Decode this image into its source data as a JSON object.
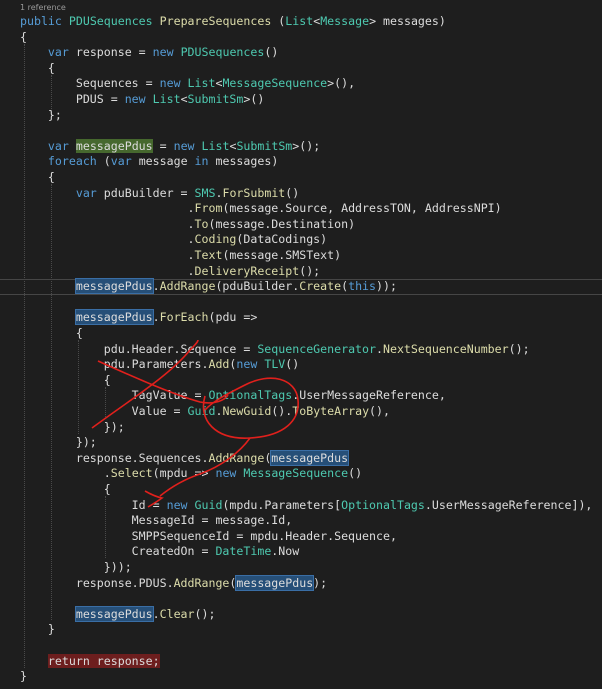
{
  "codelens": "1 reference",
  "lines": [
    {
      "tokens": [
        [
          "k",
          "public "
        ],
        [
          "t",
          "PDUSequences"
        ],
        [
          "pl",
          " "
        ],
        [
          "m",
          "PrepareSequences"
        ],
        [
          "pl",
          " ("
        ],
        [
          "t",
          "List"
        ],
        [
          "pl",
          "<"
        ],
        [
          "t",
          "Message"
        ],
        [
          "pl",
          "> messages)"
        ]
      ]
    },
    {
      "tokens": [
        [
          "pl",
          "{"
        ]
      ]
    },
    {
      "tokens": [
        [
          "pl",
          "    "
        ],
        [
          "k",
          "var"
        ],
        [
          "pl",
          " response = "
        ],
        [
          "k",
          "new"
        ],
        [
          "pl",
          " "
        ],
        [
          "t",
          "PDUSequences"
        ],
        [
          "pl",
          "()"
        ]
      ]
    },
    {
      "tokens": [
        [
          "pl",
          "    {"
        ]
      ]
    },
    {
      "tokens": [
        [
          "pl",
          "        Sequences = "
        ],
        [
          "k",
          "new"
        ],
        [
          "pl",
          " "
        ],
        [
          "t",
          "List"
        ],
        [
          "pl",
          "<"
        ],
        [
          "t",
          "MessageSequence"
        ],
        [
          "pl",
          ">(),"
        ]
      ]
    },
    {
      "tokens": [
        [
          "pl",
          "        PDUS = "
        ],
        [
          "k",
          "new"
        ],
        [
          "pl",
          " "
        ],
        [
          "t",
          "List"
        ],
        [
          "pl",
          "<"
        ],
        [
          "t",
          "SubmitSm"
        ],
        [
          "pl",
          ">()"
        ]
      ]
    },
    {
      "tokens": [
        [
          "pl",
          "    };"
        ]
      ]
    },
    {
      "tokens": []
    },
    {
      "tokens": [
        [
          "pl",
          "    "
        ],
        [
          "k",
          "var"
        ],
        [
          "pl",
          " "
        ],
        [
          "hg",
          "messagePdus"
        ],
        [
          "pl",
          " = "
        ],
        [
          "k",
          "new"
        ],
        [
          "pl",
          " "
        ],
        [
          "t",
          "List"
        ],
        [
          "pl",
          "<"
        ],
        [
          "t",
          "SubmitSm"
        ],
        [
          "pl",
          ">();"
        ]
      ]
    },
    {
      "tokens": [
        [
          "pl",
          "    "
        ],
        [
          "k",
          "foreach"
        ],
        [
          "pl",
          " ("
        ],
        [
          "k",
          "var"
        ],
        [
          "pl",
          " message "
        ],
        [
          "k",
          "in"
        ],
        [
          "pl",
          " messages)"
        ]
      ]
    },
    {
      "tokens": [
        [
          "pl",
          "    {"
        ]
      ]
    },
    {
      "tokens": [
        [
          "pl",
          "        "
        ],
        [
          "k",
          "var"
        ],
        [
          "pl",
          " pduBuilder = "
        ],
        [
          "t",
          "SMS"
        ],
        [
          "pl",
          "."
        ],
        [
          "m",
          "ForSubmit"
        ],
        [
          "pl",
          "()"
        ]
      ]
    },
    {
      "tokens": [
        [
          "pl",
          "                        ."
        ],
        [
          "m",
          "From"
        ],
        [
          "pl",
          "(message.Source, AddressTON, AddressNPI)"
        ]
      ]
    },
    {
      "tokens": [
        [
          "pl",
          "                        ."
        ],
        [
          "m",
          "To"
        ],
        [
          "pl",
          "(message.Destination)"
        ]
      ]
    },
    {
      "tokens": [
        [
          "pl",
          "                        ."
        ],
        [
          "m",
          "Coding"
        ],
        [
          "pl",
          "(DataCodings)"
        ]
      ]
    },
    {
      "tokens": [
        [
          "pl",
          "                        ."
        ],
        [
          "m",
          "Text"
        ],
        [
          "pl",
          "(message.SMSText)"
        ]
      ]
    },
    {
      "tokens": [
        [
          "pl",
          "                        ."
        ],
        [
          "m",
          "DeliveryReceipt"
        ],
        [
          "pl",
          "();"
        ]
      ]
    },
    {
      "tokens": [
        [
          "pl",
          "        "
        ],
        [
          "hb",
          "messagePdus"
        ],
        [
          "pl",
          "."
        ],
        [
          "m",
          "AddRange"
        ],
        [
          "pl",
          "(pduBuilder."
        ],
        [
          "m",
          "Create"
        ],
        [
          "pl",
          "("
        ],
        [
          "k",
          "this"
        ],
        [
          "pl",
          "));"
        ]
      ],
      "current": true
    },
    {
      "tokens": []
    },
    {
      "tokens": [
        [
          "pl",
          "        "
        ],
        [
          "hb",
          "messagePdus"
        ],
        [
          "pl",
          "."
        ],
        [
          "m",
          "ForEach"
        ],
        [
          "pl",
          "(pdu =>"
        ]
      ]
    },
    {
      "tokens": [
        [
          "pl",
          "        {"
        ]
      ]
    },
    {
      "tokens": [
        [
          "pl",
          "            pdu.Header.Sequence = "
        ],
        [
          "t",
          "SequenceGenerator"
        ],
        [
          "pl",
          "."
        ],
        [
          "m",
          "NextSequenceNumber"
        ],
        [
          "pl",
          "();"
        ]
      ]
    },
    {
      "tokens": [
        [
          "pl",
          "            pdu.Parameters."
        ],
        [
          "m",
          "Add"
        ],
        [
          "pl",
          "("
        ],
        [
          "k",
          "new"
        ],
        [
          "pl",
          " "
        ],
        [
          "t",
          "TLV"
        ],
        [
          "pl",
          "()"
        ]
      ]
    },
    {
      "tokens": [
        [
          "pl",
          "            {"
        ]
      ]
    },
    {
      "tokens": [
        [
          "pl",
          "                TagValue = "
        ],
        [
          "t",
          "OptionalTags"
        ],
        [
          "pl",
          ".UserMessageReference,"
        ]
      ]
    },
    {
      "tokens": [
        [
          "pl",
          "                Value = "
        ],
        [
          "t",
          "Guid"
        ],
        [
          "pl",
          "."
        ],
        [
          "m",
          "NewGuid"
        ],
        [
          "pl",
          "()."
        ],
        [
          "m",
          "ToByteArray"
        ],
        [
          "pl",
          "(),"
        ]
      ]
    },
    {
      "tokens": [
        [
          "pl",
          "            });"
        ]
      ]
    },
    {
      "tokens": [
        [
          "pl",
          "        });"
        ]
      ]
    },
    {
      "tokens": [
        [
          "pl",
          "        response.Sequences."
        ],
        [
          "m",
          "AddRange"
        ],
        [
          "pl",
          "("
        ],
        [
          "hb",
          "messagePdus"
        ]
      ]
    },
    {
      "tokens": [
        [
          "pl",
          "            ."
        ],
        [
          "m",
          "Select"
        ],
        [
          "pl",
          "(mpdu => "
        ],
        [
          "k",
          "new"
        ],
        [
          "pl",
          " "
        ],
        [
          "t",
          "MessageSequence"
        ],
        [
          "pl",
          "()"
        ]
      ]
    },
    {
      "tokens": [
        [
          "pl",
          "            {"
        ]
      ]
    },
    {
      "tokens": [
        [
          "pl",
          "                Id = "
        ],
        [
          "k",
          "new"
        ],
        [
          "pl",
          " "
        ],
        [
          "t",
          "Guid"
        ],
        [
          "pl",
          "(mpdu.Parameters["
        ],
        [
          "t",
          "OptionalTags"
        ],
        [
          "pl",
          ".UserMessageReference]),"
        ]
      ]
    },
    {
      "tokens": [
        [
          "pl",
          "                MessageId = message.Id,"
        ]
      ]
    },
    {
      "tokens": [
        [
          "pl",
          "                SMPPSequenceId = mpdu.Header.Sequence,"
        ]
      ]
    },
    {
      "tokens": [
        [
          "pl",
          "                CreatedOn = "
        ],
        [
          "t",
          "DateTime"
        ],
        [
          "pl",
          ".Now"
        ]
      ]
    },
    {
      "tokens": [
        [
          "pl",
          "            }));"
        ]
      ]
    },
    {
      "tokens": [
        [
          "pl",
          "        response.PDUS."
        ],
        [
          "m",
          "AddRange"
        ],
        [
          "pl",
          "("
        ],
        [
          "hb",
          "messagePdus"
        ],
        [
          "pl",
          ");"
        ]
      ]
    },
    {
      "tokens": []
    },
    {
      "tokens": [
        [
          "pl",
          "        "
        ],
        [
          "hb",
          "messagePdus"
        ],
        [
          "pl",
          "."
        ],
        [
          "m",
          "Clear"
        ],
        [
          "pl",
          "();"
        ]
      ]
    },
    {
      "tokens": [
        [
          "pl",
          "    }"
        ]
      ]
    },
    {
      "tokens": []
    },
    {
      "tokens": [
        [
          "pl",
          "    "
        ],
        [
          "hr",
          "return response;"
        ]
      ]
    },
    {
      "tokens": [
        [
          "pl",
          "}"
        ]
      ]
    }
  ]
}
